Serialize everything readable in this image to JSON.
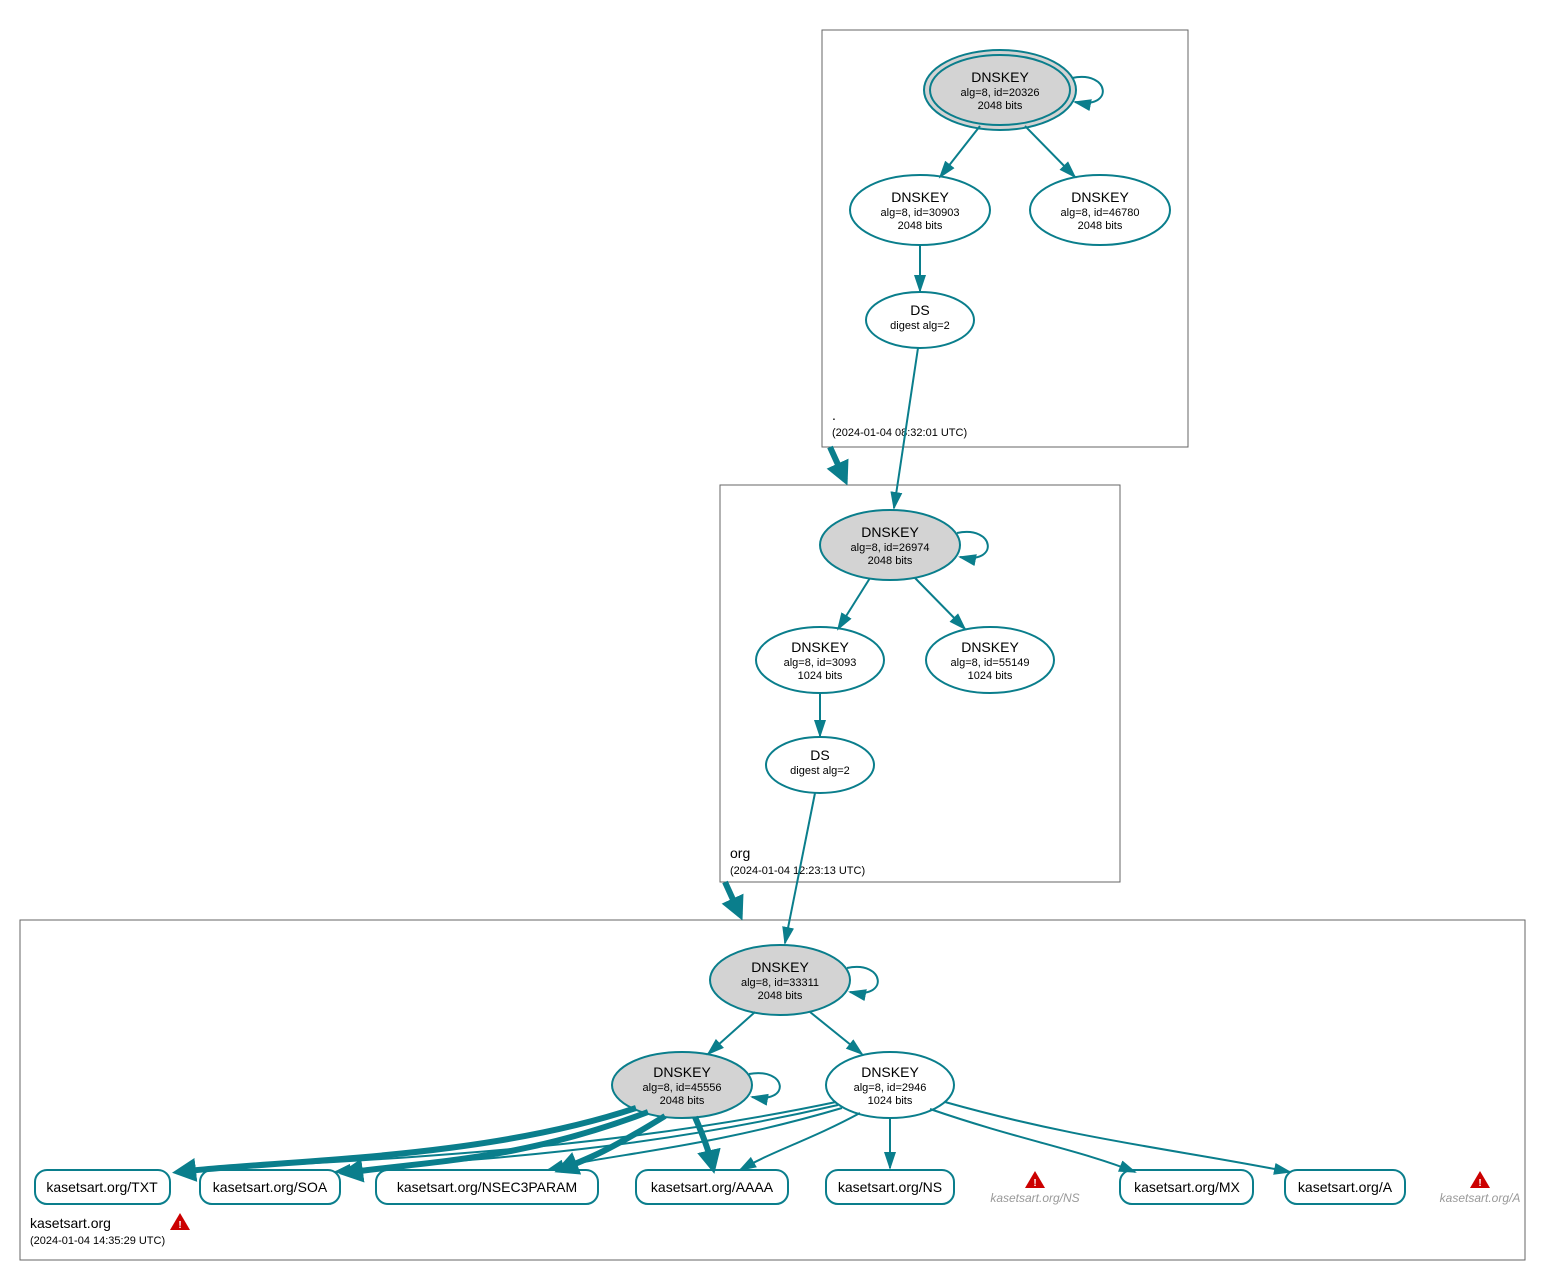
{
  "zones": {
    "root": {
      "label": ".",
      "ts": "(2024-01-04 08:32:01 UTC)"
    },
    "org": {
      "label": "org",
      "ts": "(2024-01-04 12:23:13 UTC)"
    },
    "domain": {
      "label": "kasetsart.org",
      "ts": "(2024-01-04 14:35:29 UTC)"
    }
  },
  "nodes": {
    "root_ksk": {
      "t": "DNSKEY",
      "d1": "alg=8, id=20326",
      "d2": "2048 bits"
    },
    "root_zsk1": {
      "t": "DNSKEY",
      "d1": "alg=8, id=30903",
      "d2": "2048 bits"
    },
    "root_zsk2": {
      "t": "DNSKEY",
      "d1": "alg=8, id=46780",
      "d2": "2048 bits"
    },
    "root_ds": {
      "t": "DS",
      "d1": "digest alg=2"
    },
    "org_ksk": {
      "t": "DNSKEY",
      "d1": "alg=8, id=26974",
      "d2": "2048 bits"
    },
    "org_zsk1": {
      "t": "DNSKEY",
      "d1": "alg=8, id=3093",
      "d2": "1024 bits"
    },
    "org_zsk2": {
      "t": "DNSKEY",
      "d1": "alg=8, id=55149",
      "d2": "1024 bits"
    },
    "org_ds": {
      "t": "DS",
      "d1": "digest alg=2"
    },
    "dom_ksk": {
      "t": "DNSKEY",
      "d1": "alg=8, id=33311",
      "d2": "2048 bits"
    },
    "dom_zsk1": {
      "t": "DNSKEY",
      "d1": "alg=8, id=45556",
      "d2": "2048 bits"
    },
    "dom_zsk2": {
      "t": "DNSKEY",
      "d1": "alg=8, id=2946",
      "d2": "1024 bits"
    },
    "rr_txt": "kasetsart.org/TXT",
    "rr_soa": "kasetsart.org/SOA",
    "rr_nsec3": "kasetsart.org/NSEC3PARAM",
    "rr_aaaa": "kasetsart.org/AAAA",
    "rr_ns": "kasetsart.org/NS",
    "rr_ns_ph": "kasetsart.org/NS",
    "rr_mx": "kasetsart.org/MX",
    "rr_a": "kasetsart.org/A",
    "rr_a_ph": "kasetsart.org/A"
  }
}
